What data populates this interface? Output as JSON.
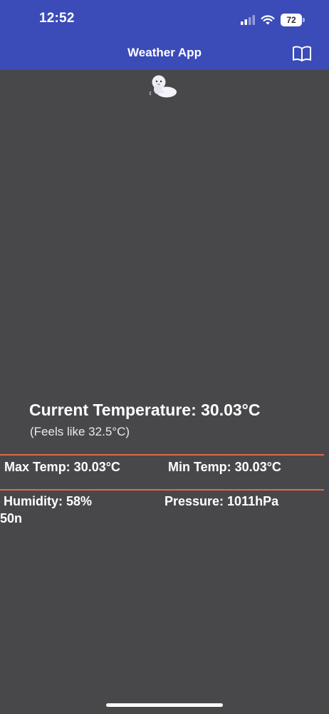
{
  "status_bar": {
    "time": "12:52",
    "battery_level": "72",
    "cellular_icon": "cellular-signal-icon",
    "wifi_icon": "wifi-icon"
  },
  "app_bar": {
    "title": "Weather App",
    "action_icon": "book-icon"
  },
  "weather": {
    "icon": "cloud-weather-icon",
    "current_temperature": "Current Temperature: 30.03°C",
    "feels_like": "(Feels like 32.5°C)",
    "max_temp": "Max Temp: 30.03°C",
    "min_temp": "Min Temp: 30.03°C",
    "humidity": "Humidity: 58%",
    "pressure": "Pressure: 1011hPa",
    "truncated_text": "50n"
  },
  "colors": {
    "app_bar": "#3b4bb8",
    "background": "#48484a",
    "divider": "#e06a47",
    "text": "#ffffff"
  }
}
